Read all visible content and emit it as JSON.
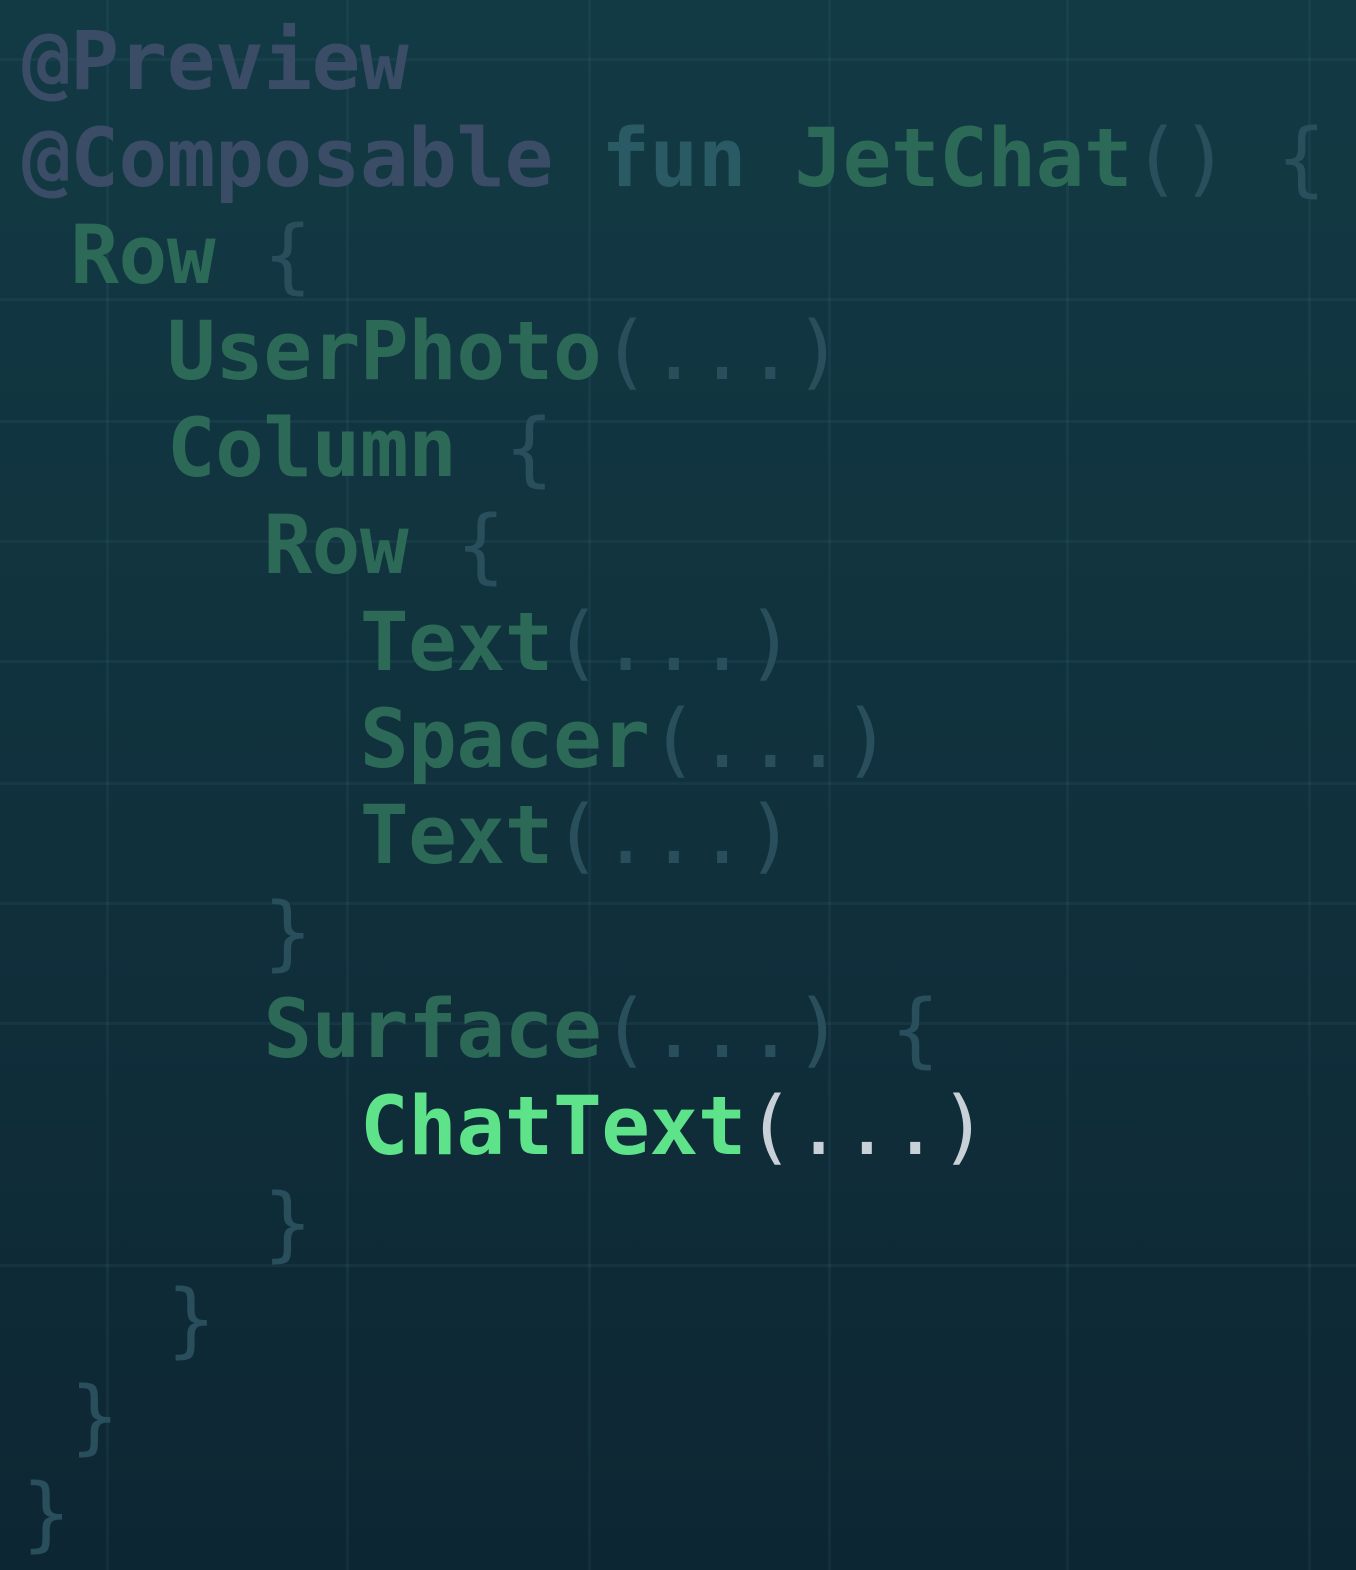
{
  "code": {
    "lines": [
      {
        "annotation": "@Preview"
      },
      {
        "annotation": "@Composable",
        "keyword": "fun",
        "name": "JetChat",
        "rest": "() {"
      },
      {
        "name": "Row",
        "rest": " {"
      },
      {
        "name": "UserPhoto",
        "rest": "(...)"
      },
      {
        "name": "Column",
        "rest": " {"
      },
      {
        "name": "Row",
        "rest": " {"
      },
      {
        "name": "Text",
        "rest": "(...)"
      },
      {
        "name": "Spacer",
        "rest": "(...)"
      },
      {
        "name": "Text",
        "rest": "(...)"
      },
      {
        "rest": "}"
      },
      {
        "name": "Surface",
        "rest": "(...) {"
      },
      {
        "name": "ChatText",
        "rest": "(...)",
        "highlighted": true
      },
      {
        "rest": "}"
      },
      {
        "rest": "}"
      },
      {
        "rest": "}"
      },
      {
        "rest": "}"
      }
    ]
  },
  "colors": {
    "background": "#123a44",
    "annotation": "#3a4c66",
    "keyword": "#2a5a63",
    "identifier": "#2c6a57",
    "punctuation": "#2a4f5c",
    "highlight": "#5ee38a",
    "highlight_punctuation": "#c8d0d8"
  }
}
